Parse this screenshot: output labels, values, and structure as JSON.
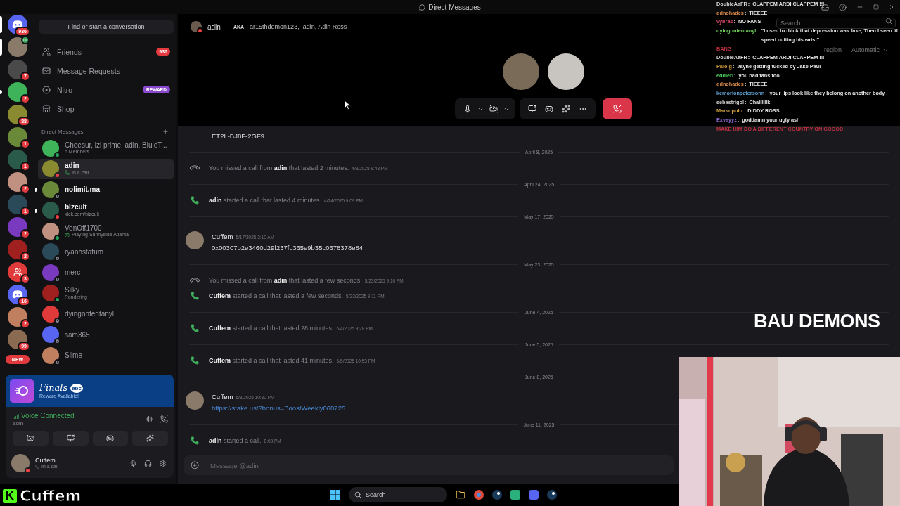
{
  "title_bar": {
    "title": "Direct Messages"
  },
  "server_rail": [
    {
      "kind": "discord",
      "badge": "936",
      "selected": true,
      "unread": false,
      "voice": false
    },
    {
      "kind": "user",
      "selected": true,
      "unread": false,
      "voice": true
    },
    {
      "kind": "user",
      "badge": "7",
      "selected": false,
      "unread": false,
      "voice": false
    },
    {
      "kind": "user",
      "badge": "2",
      "selected": false,
      "unread": true,
      "voice": false
    },
    {
      "kind": "user",
      "badge": "88",
      "selected": false,
      "unread": false,
      "voice": false
    },
    {
      "kind": "user",
      "badge": "1",
      "selected": false,
      "unread": false,
      "voice": false
    },
    {
      "kind": "user",
      "badge": "1",
      "selected": false,
      "unread": false,
      "voice": false
    },
    {
      "kind": "user",
      "badge": "2",
      "selected": false,
      "unread": false,
      "voice": false
    },
    {
      "kind": "user",
      "badge": "1",
      "selected": false,
      "unread": false,
      "voice": false
    },
    {
      "kind": "user",
      "badge": "2",
      "selected": false,
      "unread": false,
      "voice": false
    },
    {
      "kind": "user",
      "badge": "2",
      "selected": false,
      "unread": false,
      "voice": false
    },
    {
      "kind": "group",
      "badge": "3",
      "selected": false,
      "unread": false,
      "voice": false
    },
    {
      "kind": "discord",
      "badge": "16",
      "selected": false,
      "unread": false,
      "voice": false
    },
    {
      "kind": "user",
      "badge": "2",
      "selected": false,
      "unread": false,
      "voice": false
    },
    {
      "kind": "user",
      "badge": "99",
      "selected": false,
      "unread": false,
      "voice": false
    }
  ],
  "rail_new_label": "NEW",
  "search_button": "Find or start a conversation",
  "nav": [
    {
      "kind": "friends",
      "label": "Friends",
      "badge": "936"
    },
    {
      "kind": "requests",
      "label": "Message Requests"
    },
    {
      "kind": "nitro",
      "label": "Nitro",
      "tag": "REWARD"
    },
    {
      "kind": "shop",
      "label": "Shop"
    }
  ],
  "dm_header": "Direct Messages",
  "dms": [
    {
      "name": "Cheesur, izi prime, adin, BluieT...",
      "sub": {
        "kind": "text",
        "text": "5 Members"
      },
      "color": "#23a55a",
      "selected": false,
      "unread": false
    },
    {
      "name": "adin",
      "sub": {
        "kind": "call",
        "text": "In a call"
      },
      "color": "#f23f43",
      "selected": true,
      "unread": false
    },
    {
      "name": "nolimit.ma",
      "color": "#80848e",
      "selected": false,
      "unread": true
    },
    {
      "name": "bizcuit",
      "sub": {
        "kind": "text",
        "text": "kick.com/bizcuit"
      },
      "color": "#f23f43",
      "selected": false,
      "unread": true
    },
    {
      "name": "VonOff1700",
      "sub": {
        "kind": "game",
        "text": "Playing Sunnyside Atlanta"
      },
      "color": "#23a55a",
      "selected": false,
      "unread": false
    },
    {
      "name": "ryaahstatum",
      "color": "#80848e",
      "selected": false,
      "unread": false
    },
    {
      "name": "merc",
      "color": "#80848e",
      "selected": false,
      "unread": false
    },
    {
      "name": "Silky",
      "sub": {
        "kind": "text",
        "text": "Pondering"
      },
      "color": "#23a55a",
      "selected": false,
      "unread": false
    },
    {
      "name": "dyingonfentanyl",
      "color": "#80848e",
      "selected": false,
      "unread": false
    },
    {
      "name": "sam365",
      "color": "#80848e",
      "selected": false,
      "unread": false
    },
    {
      "name": "Slime",
      "color": "#80848e",
      "selected": false,
      "unread": false
    }
  ],
  "promo": {
    "title": "Finals",
    "network": "abc",
    "subtitle": "Reward Available!"
  },
  "voice": {
    "label": "Voice Connected",
    "channel": "adin"
  },
  "user_panel": {
    "name": "Cuffem",
    "status_text": "In a call",
    "color": "#f23f43"
  },
  "header": {
    "user": "adin",
    "aka_label": "AKA",
    "aka": "ar15thdemon123, !adin, Adin Ross",
    "search_placeholder": "Search",
    "region_label": "region",
    "region_value": "Automatic"
  },
  "call": {
    "mic_on": true,
    "camera_on": false
  },
  "messages": [
    {
      "kind": "text",
      "text": "ET2L-BJ8F-2GF9"
    },
    {
      "kind": "date",
      "text": "April 8, 2025"
    },
    {
      "kind": "call",
      "missed": true,
      "text": "You missed a call from **adin** that lasted 2 minutes.",
      "time": "4/8/2025 9:48 PM"
    },
    {
      "kind": "date",
      "text": "April 24, 2025"
    },
    {
      "kind": "call",
      "missed": false,
      "text": "**adin** started a call that lasted 4 minutes.",
      "time": "4/24/2025 9:09 PM"
    },
    {
      "kind": "date",
      "text": "May 17, 2025"
    },
    {
      "kind": "message",
      "author": "Cuffem",
      "time": "5/17/2025 3:10 AM",
      "text": "0x00307b2e3460d29f237fc365e9b35c0678378e84"
    },
    {
      "kind": "date",
      "text": "May 23, 2025"
    },
    {
      "kind": "call",
      "missed": true,
      "text": "You missed a call from **adin** that lasted a few seconds.",
      "time": "5/23/2025 9:10 PM"
    },
    {
      "kind": "call",
      "missed": false,
      "text": "**Cuffem** started a call that lasted a few seconds.",
      "time": "5/23/2025 9:11 PM"
    },
    {
      "kind": "date",
      "text": "June 4, 2025"
    },
    {
      "kind": "call",
      "missed": false,
      "text": "**Cuffem** started a call that lasted 28 minutes.",
      "time": "6/4/2025 9:28 PM"
    },
    {
      "kind": "date",
      "text": "June 5, 2025"
    },
    {
      "kind": "call",
      "missed": false,
      "text": "**Cuffem** started a call that lasted 41 minutes.",
      "time": "6/5/2025 10:53 PM"
    },
    {
      "kind": "date",
      "text": "June 8, 2025"
    },
    {
      "kind": "message",
      "author": "Cuffem",
      "time": "6/8/2025 10:30 PM",
      "link": "https://stake.us/?bonus=BoostWeekly060725"
    },
    {
      "kind": "date",
      "text": "June 11, 2025"
    },
    {
      "kind": "call",
      "missed": false,
      "text": "**adin** started a call.",
      "time": "8:08 PM"
    }
  ],
  "input": {
    "placeholder": "Message @adin"
  },
  "stream_chat": [
    {
      "user": "DoubleAaFR",
      "sep": ":",
      "color": "#d8d8d8",
      "text": "CLAPPEM ARDI CLAPPEM !!!"
    },
    {
      "user": "ddnohades",
      "sep": ":",
      "color": "#d98a4a",
      "text": "TIEEEE"
    },
    {
      "user": "vybras",
      "sep": ":",
      "color": "#e04a6a",
      "text": "NO FANS"
    },
    {
      "user": "dyingonfentanyl",
      "sep": ":",
      "color": "#6ecf5a",
      "text": "\"I used to think that depression was fake, Then I seen lil speed cutting his wrist\""
    },
    {
      "text": "BANG",
      "color": "#c03040"
    },
    {
      "user": "DoubleAaFR",
      "sep": ":",
      "color": "#d8d8d8",
      "text": "CLAPPEM ARDI CLAPPEM !!!"
    },
    {
      "user": "Paloig",
      "sep": ":",
      "color": "#d09a3a",
      "text": "Jayne getting fucked by Jake Paul"
    },
    {
      "user": "eddieri",
      "sep": ":",
      "color": "#4cd060",
      "text": "you had fans too"
    },
    {
      "user": "ddnohades",
      "sep": ":",
      "color": "#d98a4a",
      "text": "TIEEEE"
    },
    {
      "user": "kemorionpetersonn",
      "sep": ":",
      "color": "#5fa0d0",
      "text": "your lips look like they belong on another body"
    },
    {
      "user": "sebastrigol",
      "sep": ":",
      "color": "#cccccc",
      "text": "Chalillllk"
    },
    {
      "user": "Marsopolo",
      "sep": ":",
      "color": "#d0a040",
      "text": "DIDDY ROSS"
    },
    {
      "user": "Exvayyz",
      "sep": ":",
      "color": "#8a6ad0",
      "text": "goddamn your ugly ash"
    },
    {
      "text": "MAKE HIM DO A DIFFERENT COUNTRY ON GOOOD",
      "color": "#c03040"
    }
  ],
  "overlay_title": "BAU DEMONS",
  "streamer": {
    "logo_letter": "K",
    "name": "Cuffem"
  },
  "taskbar": {
    "search_label": "Search"
  }
}
